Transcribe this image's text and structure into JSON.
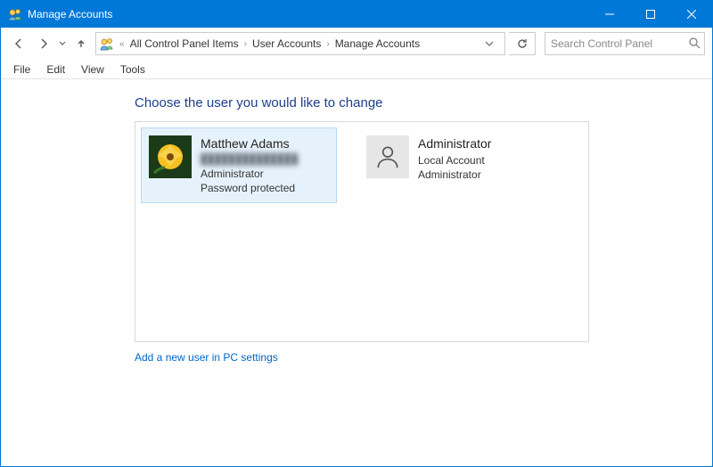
{
  "window": {
    "title": "Manage Accounts"
  },
  "breadcrumb": {
    "prefix": "«",
    "items": [
      "All Control Panel Items",
      "User Accounts",
      "Manage Accounts"
    ]
  },
  "search": {
    "placeholder": "Search Control Panel"
  },
  "menu": {
    "items": [
      "File",
      "Edit",
      "View",
      "Tools"
    ]
  },
  "page": {
    "heading": "Choose the user you would like to change",
    "add_user_link": "Add a new user in PC settings"
  },
  "accounts": [
    {
      "name": "Matthew Adams",
      "email": "██████████████",
      "role": "Administrator",
      "status": "Password protected",
      "avatar": "photo",
      "selected": true
    },
    {
      "name": "Administrator",
      "subtitle": "Local Account",
      "role": "Administrator",
      "avatar": "generic",
      "selected": false
    }
  ]
}
